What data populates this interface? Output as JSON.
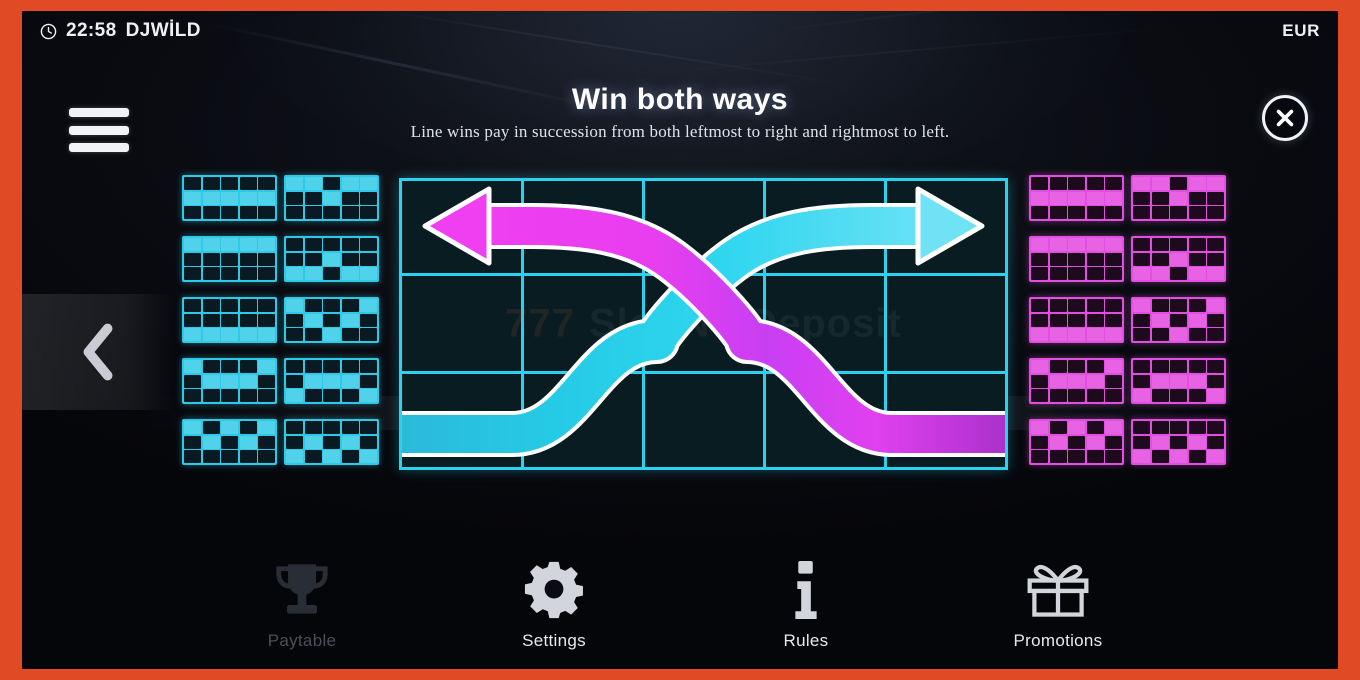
{
  "frame": {
    "border_color": "#e04a25",
    "background_color": "#05060a"
  },
  "topbar": {
    "clock_icon": "clock-icon",
    "time": "22:58",
    "game_title": "DJWİLD",
    "currency": "EUR"
  },
  "header": {
    "menu_icon": "hamburger-menu-icon",
    "close_icon": "close-icon",
    "title": "Win both ways",
    "subtitle": "Line wins pay in succession from both leftmost to right and rightmost to left."
  },
  "navigation": {
    "prev_icon": "chevron-left-icon",
    "prev_label": "Previous"
  },
  "colors": {
    "cyan": "#2ad2f0",
    "magenta": "#e14fe0",
    "grid_fill": "#081c22",
    "accent_border": "#e04a25"
  },
  "diagram": {
    "name": "win-both-ways-diagram",
    "columns": 5,
    "rows": 3,
    "watermark_seven": "777",
    "watermark_text": "Slot No Deposit",
    "arrows": [
      {
        "name": "left-arrow",
        "direction": "left",
        "color": "#e14fe0"
      },
      {
        "name": "right-arrow",
        "direction": "right",
        "color": "#2ad2f0"
      }
    ]
  },
  "paylines": {
    "grid_rows": 3,
    "grid_cols": 5,
    "left_color": "#2ad2f0",
    "right_color": "#e14fe0",
    "patterns": [
      [
        1,
        1,
        1,
        1,
        1
      ],
      [
        0,
        0,
        1,
        0,
        0
      ],
      [
        0,
        0,
        0,
        0,
        0
      ],
      [
        2,
        2,
        1,
        2,
        2
      ],
      [
        2,
        2,
        2,
        2,
        2
      ],
      [
        0,
        1,
        2,
        1,
        0
      ],
      [
        0,
        1,
        1,
        1,
        0
      ],
      [
        2,
        1,
        1,
        1,
        2
      ],
      [
        0,
        1,
        0,
        1,
        0
      ],
      [
        2,
        1,
        2,
        1,
        2
      ]
    ]
  },
  "bottom_nav": {
    "items": [
      {
        "label": "Paytable",
        "icon": "trophy-icon",
        "active": true
      },
      {
        "label": "Settings",
        "icon": "gear-icon",
        "active": false
      },
      {
        "label": "Rules",
        "icon": "info-icon",
        "active": false
      },
      {
        "label": "Promotions",
        "icon": "gift-icon",
        "active": false
      }
    ]
  }
}
